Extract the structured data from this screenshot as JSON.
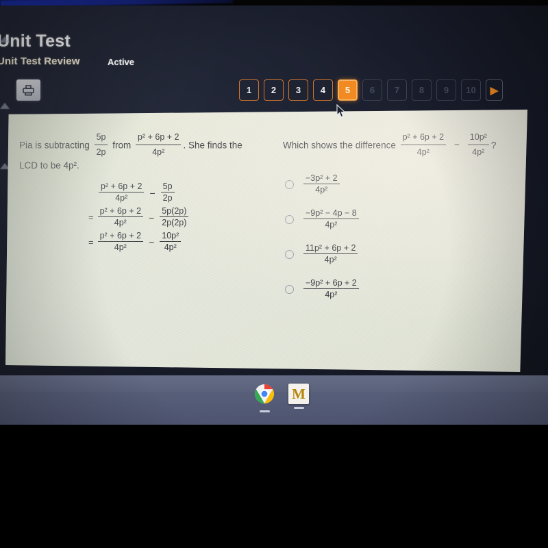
{
  "header": {
    "title": "Unit Test",
    "subtitle": "Unit Test Review",
    "status": "Active",
    "print_icon": "printer-icon"
  },
  "pager": {
    "items": [
      {
        "label": "1",
        "state": "done"
      },
      {
        "label": "2",
        "state": "done"
      },
      {
        "label": "3",
        "state": "done"
      },
      {
        "label": "4",
        "state": "done"
      },
      {
        "label": "5",
        "state": "current"
      },
      {
        "label": "6",
        "state": "todo"
      },
      {
        "label": "7",
        "state": "todo"
      },
      {
        "label": "8",
        "state": "todo"
      },
      {
        "label": "9",
        "state": "todo"
      },
      {
        "label": "10",
        "state": "todo"
      }
    ],
    "next_label": "▶",
    "current_number": "5",
    "accent_color": "#f08a21"
  },
  "question": {
    "prompt_part1": "Pia is subtracting",
    "prompt_frac1": {
      "num": "5p",
      "den": "2p"
    },
    "prompt_part2": "from",
    "prompt_frac2": {
      "num": "p² + 6p + 2",
      "den": "4p²"
    },
    "prompt_part3": ". She finds the",
    "prompt_line2": "LCD to be 4p².",
    "work": [
      {
        "eq": "",
        "left": {
          "num": "p² + 6p + 2",
          "den": "4p²"
        },
        "op": "−",
        "right": {
          "num": "5p",
          "den": "2p"
        }
      },
      {
        "eq": "=",
        "left": {
          "num": "p² + 6p + 2",
          "den": "4p²"
        },
        "op": "−",
        "right": {
          "num": "5p(2p)",
          "den": "2p(2p)"
        }
      },
      {
        "eq": "=",
        "left": {
          "num": "p² + 6p + 2",
          "den": "4p²"
        },
        "op": "−",
        "right": {
          "num": "10p²",
          "den": "4p²"
        }
      }
    ]
  },
  "answer_panel": {
    "prompt": "Which shows the difference",
    "prompt_frac1": {
      "num": "p² + 6p + 2",
      "den": "4p²"
    },
    "prompt_op": "−",
    "prompt_frac2": {
      "num": "10p²",
      "den": "4p²"
    },
    "prompt_end": "?",
    "choices": [
      {
        "num": "−3p² + 2",
        "den": "4p²",
        "selected": false
      },
      {
        "num": "−9p² − 4p − 8",
        "den": "4p²",
        "selected": false
      },
      {
        "num": "11p² + 6p + 2",
        "den": "4p²",
        "selected": false
      },
      {
        "num": "−9p² + 6p + 2",
        "den": "4p²",
        "selected": false
      }
    ]
  },
  "taskbar": {
    "items": [
      {
        "name": "chrome-icon",
        "label": "Chrome"
      },
      {
        "name": "m-app-icon",
        "label": "M"
      }
    ]
  }
}
